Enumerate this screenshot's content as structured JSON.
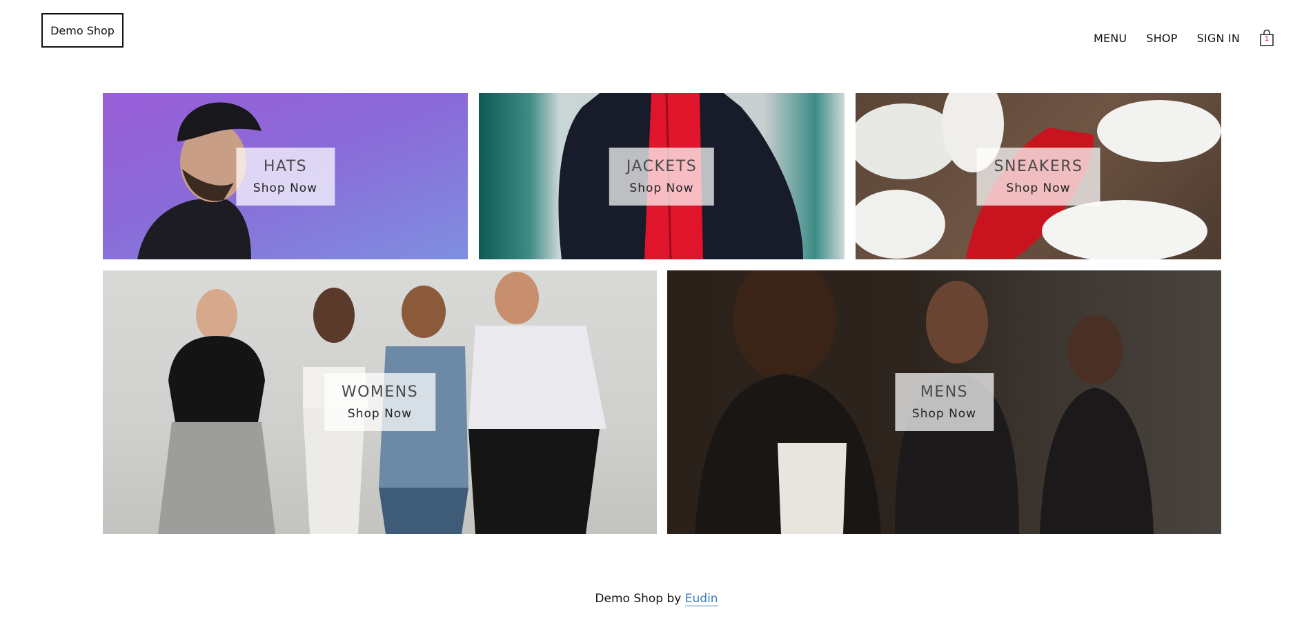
{
  "header": {
    "logo": "Demo Shop",
    "nav": [
      "MENU",
      "SHOP",
      "SIGN IN"
    ],
    "cart_icon": "shopping-bag-icon",
    "cart_count": "1"
  },
  "categories": [
    {
      "title": "HATS",
      "cta": "Shop Now"
    },
    {
      "title": "JACKETS",
      "cta": "Shop Now"
    },
    {
      "title": "SNEAKERS",
      "cta": "Shop Now"
    },
    {
      "title": "WOMENS",
      "cta": "Shop Now"
    },
    {
      "title": "MENS",
      "cta": "Shop Now"
    }
  ],
  "footer": {
    "text": "Demo Shop by ",
    "link": "Eudin"
  },
  "colors": {
    "link": "#3b7bc4",
    "cart_count": "#dd1111"
  }
}
